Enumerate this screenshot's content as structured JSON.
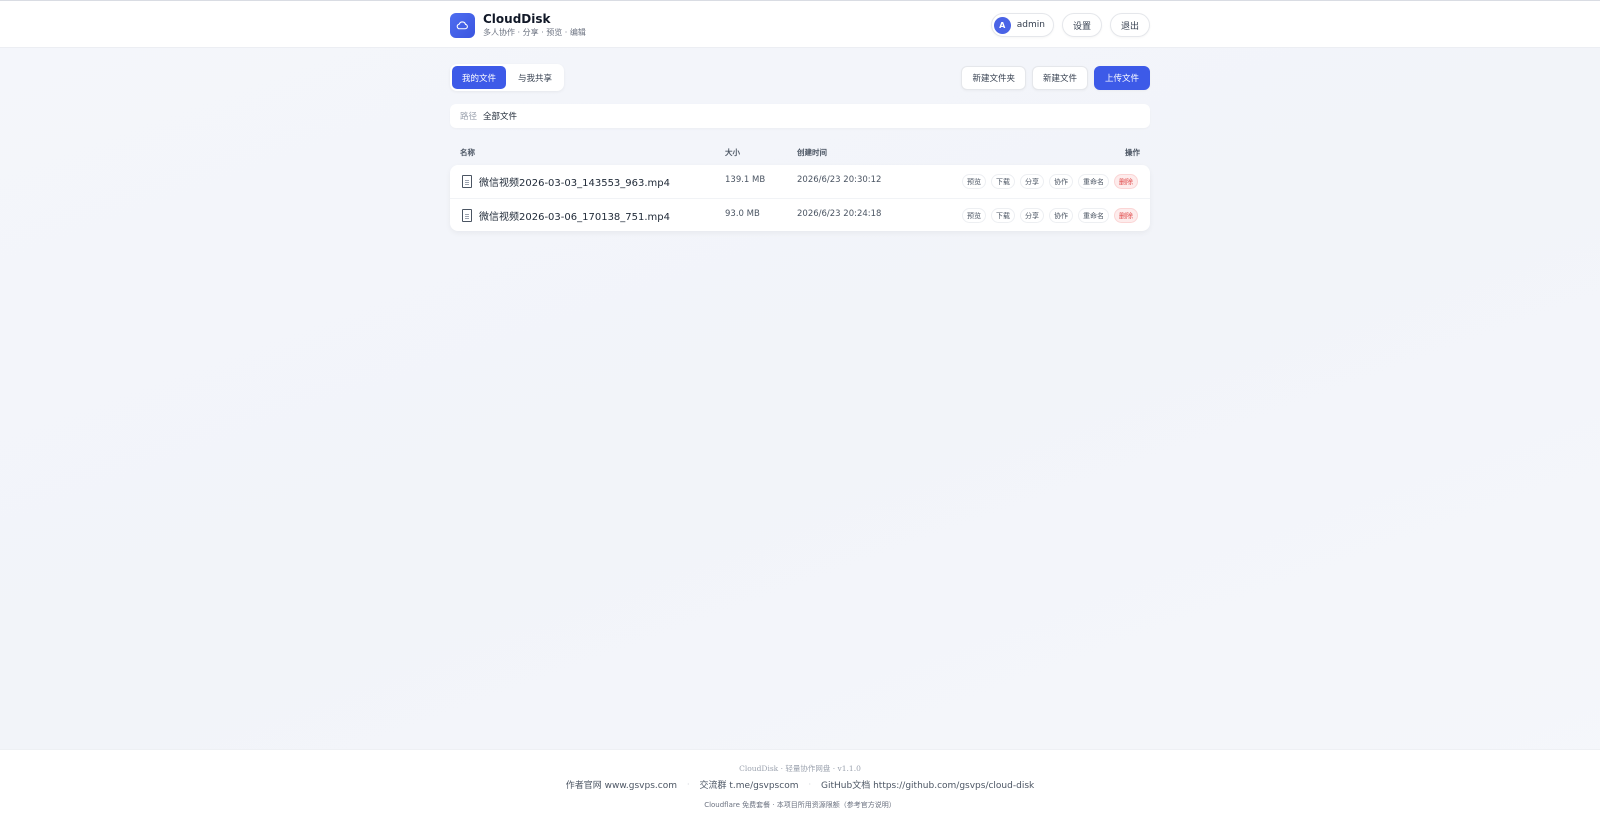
{
  "header": {
    "app_name": "CloudDisk",
    "subtitle": "多人协作 · 分享 · 预览 · 编辑",
    "user": {
      "avatar_letter": "A",
      "name": "admin"
    },
    "settings_label": "设置",
    "logout_label": "退出"
  },
  "tabs": [
    {
      "label": "我的文件",
      "active": true
    },
    {
      "label": "与我共享",
      "active": false
    }
  ],
  "toolbar": {
    "new_folder_label": "新建文件夹",
    "new_file_label": "新建文件",
    "upload_label": "上传文件"
  },
  "path": {
    "label": "路径",
    "value": "全部文件"
  },
  "table": {
    "columns": {
      "name": "名称",
      "size": "大小",
      "created": "创建时间",
      "actions": "操作"
    },
    "rows": [
      {
        "name": "微信视频2026-03-03_143553_963.mp4",
        "size": "139.1 MB",
        "created": "2026/6/23 20:30:12"
      },
      {
        "name": "微信视频2026-03-06_170138_751.mp4",
        "size": "93.0 MB",
        "created": "2026/6/23 20:24:18"
      }
    ],
    "row_actions": {
      "preview": "预览",
      "download": "下载",
      "share": "分享",
      "collab": "协作",
      "rename": "重命名",
      "delete": "删除"
    }
  },
  "footer": {
    "version_line": "CloudDisk · 轻量协作网盘 · v1.1.0",
    "author": "作者官网 www.gsvps.com",
    "group": "交流群 t.me/gsvpscom",
    "github": "GitHub文档 https://github.com/gsvps/cloud-disk",
    "separator": "·",
    "notice": "Cloudflare 免费套餐 · 本项目所用资源限额（参考官方说明）"
  },
  "colors": {
    "accent": "#3d5ae8",
    "danger": "#e04848",
    "background": "#f3f5f9"
  }
}
